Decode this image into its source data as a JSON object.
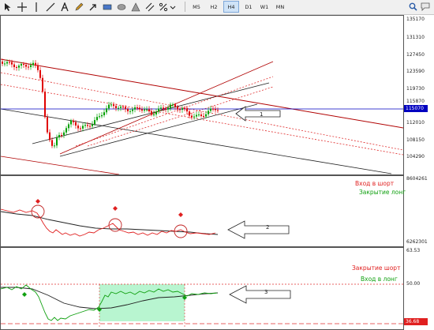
{
  "toolbar": {
    "timeframes": [
      {
        "label": "M5",
        "active": false
      },
      {
        "label": "H2",
        "active": false
      },
      {
        "label": "H4",
        "active": true
      },
      {
        "label": "D1",
        "active": false
      },
      {
        "label": "W1",
        "active": false
      },
      {
        "label": "MN",
        "active": false
      }
    ]
  },
  "price_panel": {
    "axis_labels": [
      "135170",
      "131310",
      "127450",
      "123590",
      "119730",
      "115870",
      "112010",
      "108150",
      "104290"
    ],
    "current_price": "115070",
    "arrow_label": "1",
    "colors": {
      "up_candle": "#00a000",
      "down_candle": "#e00000",
      "channel": "#b00000",
      "current_line": "#0000c0"
    }
  },
  "indicator1": {
    "axis_top": "8604261",
    "axis_bottom": "6262301",
    "legend_short": "Вход в шорт",
    "legend_close_long": "Закрытие лонг",
    "arrow_label": "2",
    "colors": {
      "short": "#e02020",
      "close_long": "#10a010"
    }
  },
  "indicator2": {
    "axis_top": "63.53",
    "axis_mid": "50.00",
    "axis_bottom": "36.68",
    "legend_close_short": "Закрытие шорт",
    "legend_long": "Вход в лонг",
    "arrow_label": "3",
    "colors": {
      "close_short": "#e02020",
      "long": "#10a010",
      "zone": "#b8f5d0"
    }
  }
}
